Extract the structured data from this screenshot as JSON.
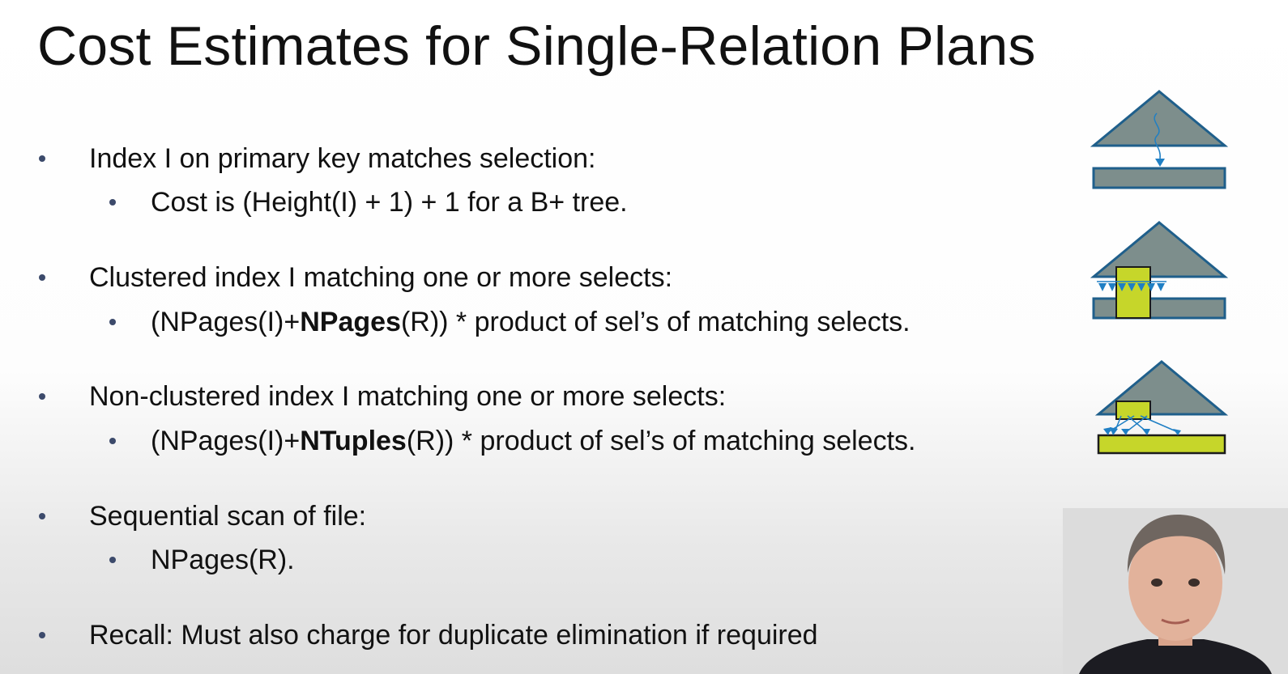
{
  "title": "Cost Estimates for Single-Relation Plans",
  "bullets": [
    {
      "text": "Index I on primary key matches selection:",
      "sub": [
        {
          "pre": "Cost is (Height(I) + 1) + 1 for a B+ tree.",
          "bold": "",
          "post": ""
        }
      ]
    },
    {
      "text": "Clustered index I matching one or more selects:",
      "sub": [
        {
          "pre": "(NPages(I)+",
          "bold": "NPages",
          "post": "(R)) * product of sel’s of matching selects."
        }
      ]
    },
    {
      "text": "Non-clustered index I matching one or more selects:",
      "sub": [
        {
          "pre": "(NPages(I)+",
          "bold": "NTuples",
          "post": "(R)) * product of sel’s of matching selects."
        }
      ]
    },
    {
      "text": "Sequential scan of file:",
      "sub": [
        {
          "pre": "NPages(R).",
          "bold": "",
          "post": ""
        }
      ]
    },
    {
      "text": "Recall: Must also charge for duplicate elimination if required",
      "sub": []
    }
  ],
  "colors": {
    "tree_fill": "#7d8e8c",
    "tree_stroke": "#1f5f8b",
    "arrow": "#1f7fc4",
    "highlight": "#c6d62a"
  },
  "diagrams": [
    "primary-key-index-diagram",
    "clustered-index-diagram",
    "non-clustered-index-diagram"
  ]
}
